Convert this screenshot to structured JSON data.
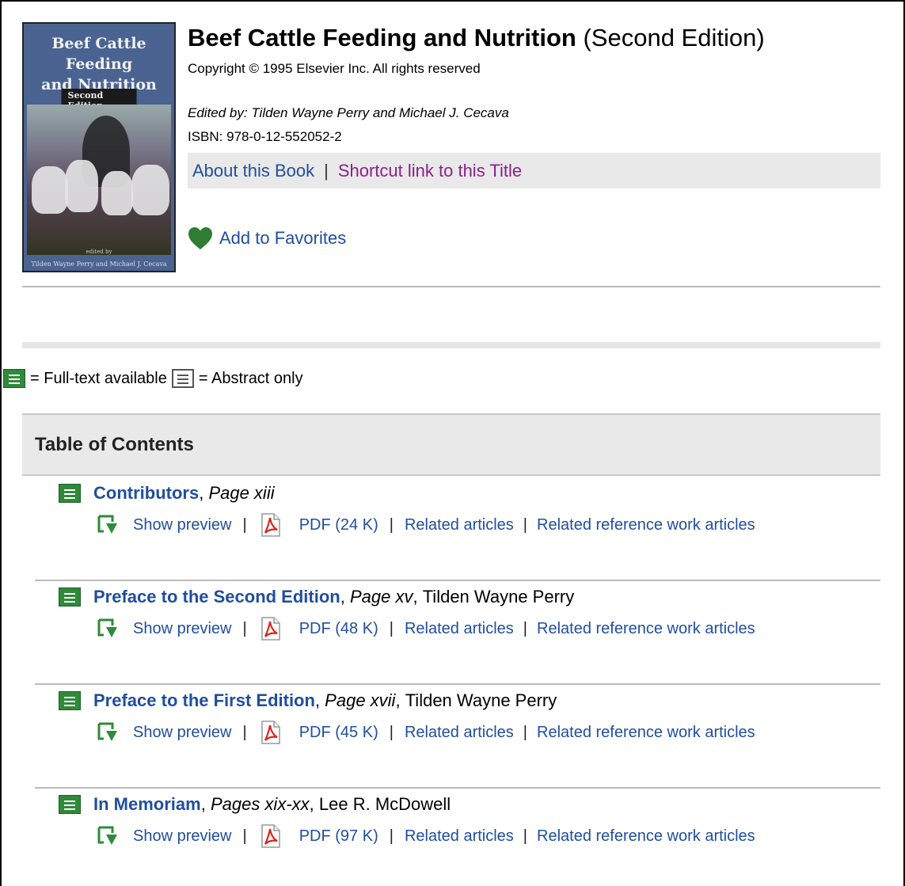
{
  "book": {
    "title": "Beef Cattle Feeding and Nutrition",
    "edition": "(Second Edition)",
    "copyright": "Copyright © 1995 Elsevier Inc. All rights reserved",
    "editors": "Edited by: Tilden Wayne Perry and Michael J. Cecava",
    "isbn": "ISBN: 978-0-12-552052-2",
    "cover": {
      "title_line1": "Beef Cattle Feeding",
      "title_line2": "and Nutrition",
      "edition": "Second Edition",
      "edited_by": "edited by",
      "editors": "Tilden Wayne Perry and Michael J. Cecava"
    }
  },
  "links": {
    "about": "About this Book",
    "separator": "|",
    "shortcut": "Shortcut link to this Title",
    "favorites": "Add to Favorites"
  },
  "legend": {
    "full_text": "= Full-text available",
    "abstract": "= Abstract only"
  },
  "toc": {
    "heading": "Table of Contents",
    "entries": [
      {
        "title": "Contributors",
        "page": "Page xiii",
        "author": "",
        "preview": "Show preview",
        "pdf": "PDF (24 K)",
        "related": "Related articles",
        "related_ref": "Related reference work articles"
      },
      {
        "title": "Preface to the Second Edition",
        "page": "Page xv",
        "author": "Tilden Wayne Perry",
        "preview": "Show preview",
        "pdf": "PDF (48 K)",
        "related": "Related articles",
        "related_ref": "Related reference work articles"
      },
      {
        "title": "Preface to the First Edition",
        "page": "Page xvii",
        "author": "Tilden Wayne Perry",
        "preview": "Show preview",
        "pdf": "PDF (45 K)",
        "related": "Related articles",
        "related_ref": "Related reference work articles"
      },
      {
        "title": "In Memoriam",
        "page": "Pages xix-xx",
        "author": "Lee R. McDowell",
        "preview": "Show preview",
        "pdf": "PDF (97 K)",
        "related": "Related articles",
        "related_ref": "Related reference work articles"
      }
    ]
  },
  "colors": {
    "link": "#1f4e9e",
    "visited_link": "#8b1f8c",
    "fulltext_icon": "#2f8a3a",
    "favorite_heart": "#2e7d32"
  },
  "icons": {
    "fulltext": "document-green-icon",
    "abstract": "document-outline-icon",
    "preview": "preview-arrow-icon",
    "pdf": "pdf-icon",
    "favorite": "heart-icon"
  }
}
